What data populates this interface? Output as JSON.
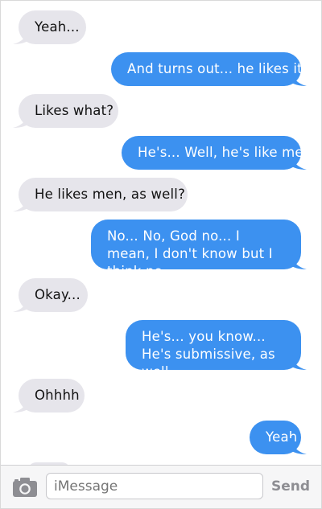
{
  "messages": [
    {
      "side": "in",
      "text": "Yeah..."
    },
    {
      "side": "out",
      "text": "And turns out... he likes it"
    },
    {
      "side": "in",
      "text": "Likes what?"
    },
    {
      "side": "out",
      "text": "He's... Well, he's like me"
    },
    {
      "side": "in",
      "text": "He likes men, as well?"
    },
    {
      "side": "out",
      "text": "No... No, God no... I mean, I don't know but I think no"
    },
    {
      "side": "in",
      "text": "Okay..."
    },
    {
      "side": "out",
      "text": "He's... you know... He's submissive, as well"
    },
    {
      "side": "in",
      "text": "Ohhhh"
    },
    {
      "side": "out",
      "text": "Yeah"
    }
  ],
  "input_bar": {
    "camera_icon": "camera-icon",
    "placeholder": "iMessage",
    "send_label": "Send"
  },
  "colors": {
    "incoming": "#e6e5eb",
    "outgoing": "#3c91f0",
    "send_disabled": "#8e8e93"
  }
}
